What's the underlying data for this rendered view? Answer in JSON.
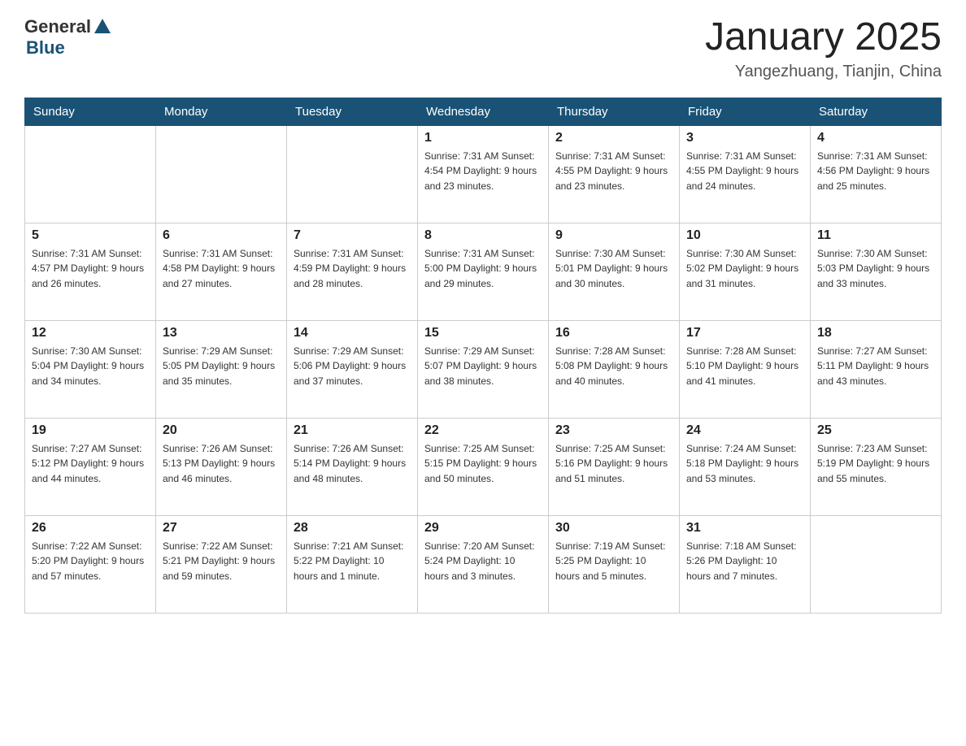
{
  "header": {
    "logo_general": "General",
    "logo_blue": "Blue",
    "month_title": "January 2025",
    "location": "Yangezhuang, Tianjin, China"
  },
  "days_of_week": [
    "Sunday",
    "Monday",
    "Tuesday",
    "Wednesday",
    "Thursday",
    "Friday",
    "Saturday"
  ],
  "weeks": [
    [
      {
        "day": "",
        "info": ""
      },
      {
        "day": "",
        "info": ""
      },
      {
        "day": "",
        "info": ""
      },
      {
        "day": "1",
        "info": "Sunrise: 7:31 AM\nSunset: 4:54 PM\nDaylight: 9 hours\nand 23 minutes."
      },
      {
        "day": "2",
        "info": "Sunrise: 7:31 AM\nSunset: 4:55 PM\nDaylight: 9 hours\nand 23 minutes."
      },
      {
        "day": "3",
        "info": "Sunrise: 7:31 AM\nSunset: 4:55 PM\nDaylight: 9 hours\nand 24 minutes."
      },
      {
        "day": "4",
        "info": "Sunrise: 7:31 AM\nSunset: 4:56 PM\nDaylight: 9 hours\nand 25 minutes."
      }
    ],
    [
      {
        "day": "5",
        "info": "Sunrise: 7:31 AM\nSunset: 4:57 PM\nDaylight: 9 hours\nand 26 minutes."
      },
      {
        "day": "6",
        "info": "Sunrise: 7:31 AM\nSunset: 4:58 PM\nDaylight: 9 hours\nand 27 minutes."
      },
      {
        "day": "7",
        "info": "Sunrise: 7:31 AM\nSunset: 4:59 PM\nDaylight: 9 hours\nand 28 minutes."
      },
      {
        "day": "8",
        "info": "Sunrise: 7:31 AM\nSunset: 5:00 PM\nDaylight: 9 hours\nand 29 minutes."
      },
      {
        "day": "9",
        "info": "Sunrise: 7:30 AM\nSunset: 5:01 PM\nDaylight: 9 hours\nand 30 minutes."
      },
      {
        "day": "10",
        "info": "Sunrise: 7:30 AM\nSunset: 5:02 PM\nDaylight: 9 hours\nand 31 minutes."
      },
      {
        "day": "11",
        "info": "Sunrise: 7:30 AM\nSunset: 5:03 PM\nDaylight: 9 hours\nand 33 minutes."
      }
    ],
    [
      {
        "day": "12",
        "info": "Sunrise: 7:30 AM\nSunset: 5:04 PM\nDaylight: 9 hours\nand 34 minutes."
      },
      {
        "day": "13",
        "info": "Sunrise: 7:29 AM\nSunset: 5:05 PM\nDaylight: 9 hours\nand 35 minutes."
      },
      {
        "day": "14",
        "info": "Sunrise: 7:29 AM\nSunset: 5:06 PM\nDaylight: 9 hours\nand 37 minutes."
      },
      {
        "day": "15",
        "info": "Sunrise: 7:29 AM\nSunset: 5:07 PM\nDaylight: 9 hours\nand 38 minutes."
      },
      {
        "day": "16",
        "info": "Sunrise: 7:28 AM\nSunset: 5:08 PM\nDaylight: 9 hours\nand 40 minutes."
      },
      {
        "day": "17",
        "info": "Sunrise: 7:28 AM\nSunset: 5:10 PM\nDaylight: 9 hours\nand 41 minutes."
      },
      {
        "day": "18",
        "info": "Sunrise: 7:27 AM\nSunset: 5:11 PM\nDaylight: 9 hours\nand 43 minutes."
      }
    ],
    [
      {
        "day": "19",
        "info": "Sunrise: 7:27 AM\nSunset: 5:12 PM\nDaylight: 9 hours\nand 44 minutes."
      },
      {
        "day": "20",
        "info": "Sunrise: 7:26 AM\nSunset: 5:13 PM\nDaylight: 9 hours\nand 46 minutes."
      },
      {
        "day": "21",
        "info": "Sunrise: 7:26 AM\nSunset: 5:14 PM\nDaylight: 9 hours\nand 48 minutes."
      },
      {
        "day": "22",
        "info": "Sunrise: 7:25 AM\nSunset: 5:15 PM\nDaylight: 9 hours\nand 50 minutes."
      },
      {
        "day": "23",
        "info": "Sunrise: 7:25 AM\nSunset: 5:16 PM\nDaylight: 9 hours\nand 51 minutes."
      },
      {
        "day": "24",
        "info": "Sunrise: 7:24 AM\nSunset: 5:18 PM\nDaylight: 9 hours\nand 53 minutes."
      },
      {
        "day": "25",
        "info": "Sunrise: 7:23 AM\nSunset: 5:19 PM\nDaylight: 9 hours\nand 55 minutes."
      }
    ],
    [
      {
        "day": "26",
        "info": "Sunrise: 7:22 AM\nSunset: 5:20 PM\nDaylight: 9 hours\nand 57 minutes."
      },
      {
        "day": "27",
        "info": "Sunrise: 7:22 AM\nSunset: 5:21 PM\nDaylight: 9 hours\nand 59 minutes."
      },
      {
        "day": "28",
        "info": "Sunrise: 7:21 AM\nSunset: 5:22 PM\nDaylight: 10 hours\nand 1 minute."
      },
      {
        "day": "29",
        "info": "Sunrise: 7:20 AM\nSunset: 5:24 PM\nDaylight: 10 hours\nand 3 minutes."
      },
      {
        "day": "30",
        "info": "Sunrise: 7:19 AM\nSunset: 5:25 PM\nDaylight: 10 hours\nand 5 minutes."
      },
      {
        "day": "31",
        "info": "Sunrise: 7:18 AM\nSunset: 5:26 PM\nDaylight: 10 hours\nand 7 minutes."
      },
      {
        "day": "",
        "info": ""
      }
    ]
  ]
}
